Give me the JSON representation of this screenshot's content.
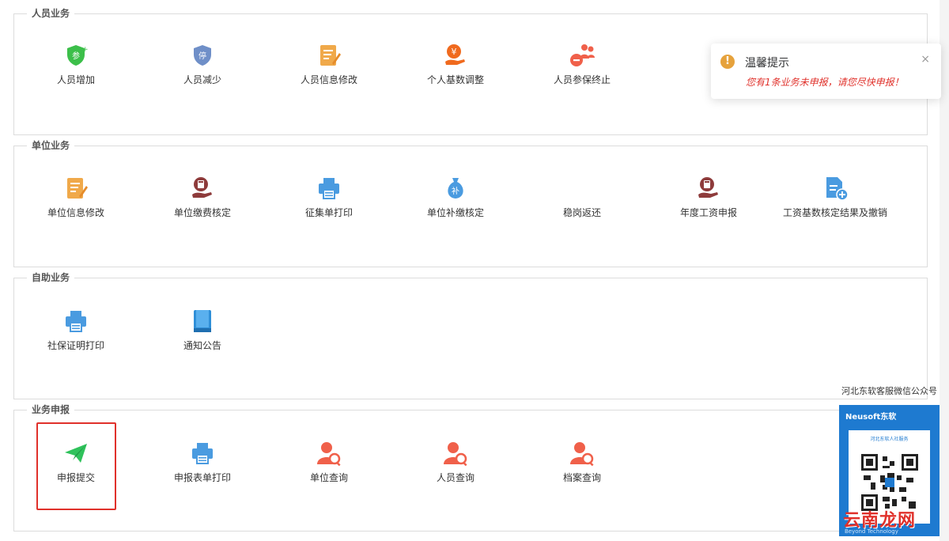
{
  "sections": [
    {
      "title": "人员业务",
      "items": [
        {
          "label": "人员增加",
          "icon": "person-add-shield-icon"
        },
        {
          "label": "人员减少",
          "icon": "person-stop-shield-icon"
        },
        {
          "label": "人员信息修改",
          "icon": "edit-document-icon"
        },
        {
          "label": "个人基数调整",
          "icon": "hand-money-icon"
        },
        {
          "label": "人员参保终止",
          "icon": "group-remove-icon"
        }
      ]
    },
    {
      "title": "单位业务",
      "items": [
        {
          "label": "单位信息修改",
          "icon": "edit-document-icon"
        },
        {
          "label": "单位缴费核定",
          "icon": "hand-calculator-icon"
        },
        {
          "label": "征集单打印",
          "icon": "printer-icon"
        },
        {
          "label": "单位补缴核定",
          "icon": "money-bag-icon"
        },
        {
          "label": "稳岗返还",
          "icon": "return-icon"
        },
        {
          "label": "年度工资申报",
          "icon": "hand-calculator-icon"
        },
        {
          "label": "工资基数核定结果及撤销",
          "icon": "file-add-icon"
        }
      ]
    },
    {
      "title": "自助业务",
      "items": [
        {
          "label": "社保证明打印",
          "icon": "printer-icon"
        },
        {
          "label": "通知公告",
          "icon": "book-icon"
        }
      ]
    },
    {
      "title": "业务申报",
      "items": [
        {
          "label": "申报提交",
          "icon": "paper-plane-icon"
        },
        {
          "label": "申报表单打印",
          "icon": "printer-icon"
        },
        {
          "label": "单位查询",
          "icon": "person-search-icon"
        },
        {
          "label": "人员查询",
          "icon": "person-search-icon"
        },
        {
          "label": "档案查询",
          "icon": "person-search-icon"
        }
      ]
    }
  ],
  "notification": {
    "title": "温馨提示",
    "message": "您有1条业务未申报，请您尽快申报！",
    "close": "×",
    "icon": "!"
  },
  "qr": {
    "caption": "河北东软客服微信公众号",
    "brand": "Neusoft东软",
    "subtitle": "河北东软人社服务",
    "footer": "Beyond Technology",
    "watermark": "云南龙网"
  },
  "colors": {
    "accent_red": "#e0312b",
    "warning": "#e6a23c",
    "qr_blue": "#1e7ad0"
  }
}
